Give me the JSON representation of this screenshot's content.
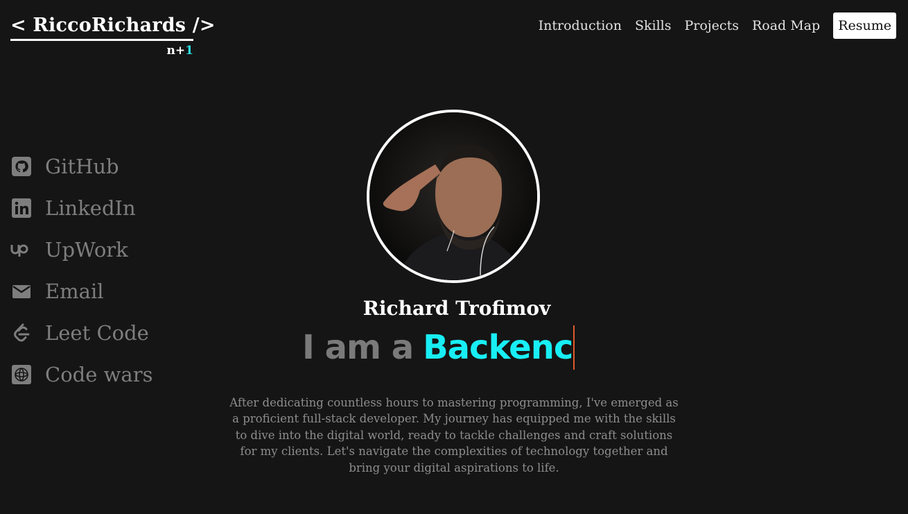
{
  "logo": {
    "title": "< RiccoRichards />",
    "sub_prefix": "n+",
    "sub_accent": "1"
  },
  "nav": {
    "items": [
      "Introduction",
      "Skills",
      "Projects",
      "Road Map"
    ],
    "resume_label": "Resume"
  },
  "socials": [
    {
      "label": "GitHub",
      "icon": "github-icon"
    },
    {
      "label": "LinkedIn",
      "icon": "linkedin-icon"
    },
    {
      "label": "UpWork",
      "icon": "upwork-icon"
    },
    {
      "label": "Email",
      "icon": "email-icon"
    },
    {
      "label": "Leet Code",
      "icon": "leetcode-icon"
    },
    {
      "label": "Code wars",
      "icon": "codewars-icon"
    }
  ],
  "hero": {
    "name": "Richard Trofimov",
    "tagline_prefix": "I am a",
    "tagline_typed": "Backenc",
    "bio": "After dedicating countless hours to mastering programming, I've emerged as a proficient full-stack developer. My journey has equipped me with the skills to dive into the digital world, ready to tackle challenges and craft solutions for my clients. Let's navigate the complexities of technology together and bring your digital aspirations to life."
  },
  "colors": {
    "background": "#151515",
    "accent": "#18eef5",
    "muted": "#7e7e7e",
    "cursor": "#e05a2a"
  }
}
